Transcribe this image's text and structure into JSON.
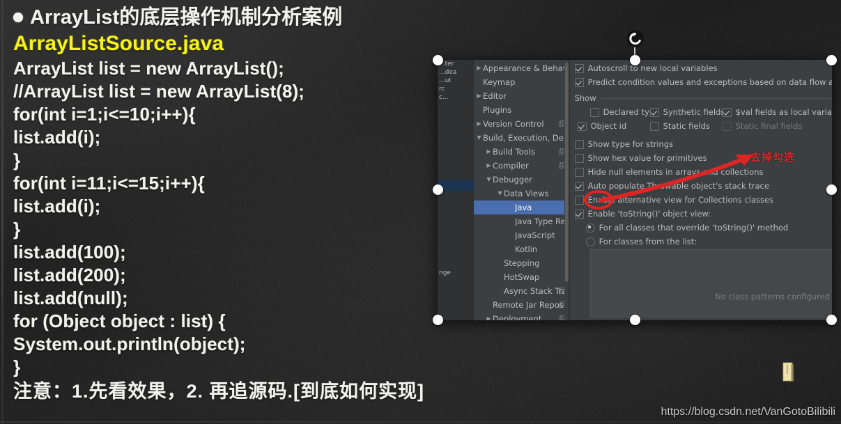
{
  "slide": {
    "bullet_title": "ArrayList的底层操作机制分析案例",
    "file_name": "ArrayListSource.java",
    "code_lines": [
      "ArrayList list = new ArrayList();",
      "//ArrayList list = new ArrayList(8);",
      "for(int i=1;i<=10;i++){",
      "list.add(i);",
      "}",
      "for(int i=11;i<=15;i++){",
      "list.add(i);",
      "}",
      "list.add(100);",
      "list.add(200);",
      "list.add(null);",
      "for (Object object : list) {",
      "System.out.println(object);",
      "}"
    ],
    "note": "注意：1.先看效果，2. 再追源码.[到底如何实现]",
    "watermark": "https://blog.csdn.net/VanGotoBilibili"
  },
  "annotation": {
    "text": "去掉勾选",
    "color": "#d42b2b"
  },
  "ide": {
    "project_tree_fragment": [
      "...ter",
      "...dea",
      "...ut",
      "rc",
      "c...",
      "",
      "",
      "",
      "",
      "",
      "",
      "",
      "nge"
    ],
    "settings_tree": [
      {
        "label": "Appearance & Behavior",
        "arrow": "right",
        "indent": 0,
        "badge": false,
        "selected": false
      },
      {
        "label": "Keymap",
        "arrow": "none",
        "indent": 0,
        "badge": false,
        "selected": false
      },
      {
        "label": "Editor",
        "arrow": "right",
        "indent": 0,
        "badge": false,
        "selected": false
      },
      {
        "label": "Plugins",
        "arrow": "none",
        "indent": 0,
        "badge": false,
        "selected": false
      },
      {
        "label": "Version Control",
        "arrow": "right",
        "indent": 0,
        "badge": true,
        "selected": false
      },
      {
        "label": "Build, Execution, Deployment",
        "arrow": "down",
        "indent": 0,
        "badge": false,
        "selected": false
      },
      {
        "label": "Build Tools",
        "arrow": "right",
        "indent": 1,
        "badge": true,
        "selected": false
      },
      {
        "label": "Compiler",
        "arrow": "right",
        "indent": 1,
        "badge": true,
        "selected": false
      },
      {
        "label": "Debugger",
        "arrow": "down",
        "indent": 1,
        "badge": false,
        "selected": false
      },
      {
        "label": "Data Views",
        "arrow": "down",
        "indent": 2,
        "badge": false,
        "selected": false
      },
      {
        "label": "Java",
        "arrow": "none",
        "indent": 3,
        "badge": false,
        "selected": true
      },
      {
        "label": "Java Type Renderers",
        "arrow": "none",
        "indent": 3,
        "badge": false,
        "selected": false
      },
      {
        "label": "JavaScript",
        "arrow": "none",
        "indent": 3,
        "badge": false,
        "selected": false
      },
      {
        "label": "Kotlin",
        "arrow": "none",
        "indent": 3,
        "badge": false,
        "selected": false
      },
      {
        "label": "Stepping",
        "arrow": "none",
        "indent": 2,
        "badge": false,
        "selected": false
      },
      {
        "label": "HotSwap",
        "arrow": "none",
        "indent": 2,
        "badge": false,
        "selected": false
      },
      {
        "label": "Async Stack Traces",
        "arrow": "none",
        "indent": 2,
        "badge": true,
        "selected": false
      },
      {
        "label": "Remote Jar Repositories",
        "arrow": "none",
        "indent": 1,
        "badge": true,
        "selected": false
      },
      {
        "label": "Deployment",
        "arrow": "right",
        "indent": 1,
        "badge": true,
        "selected": false
      }
    ],
    "options": {
      "autoscroll": {
        "label": "Autoscroll to new local variables",
        "checked": true
      },
      "predict": {
        "label": "Predict condition values and exceptions based on data flow analysis",
        "checked": true
      },
      "show_group_label": "Show",
      "show_group": [
        {
          "label": "Declared type",
          "checked": false,
          "dim": false
        },
        {
          "label": "Synthetic fields",
          "checked": true,
          "dim": false
        },
        {
          "label": "$val fields as local variab",
          "checked": true,
          "dim": false
        },
        {
          "label": "Object id",
          "checked": true,
          "dim": false
        },
        {
          "label": "Static fields",
          "checked": false,
          "dim": false
        },
        {
          "label": "Static final fields",
          "checked": false,
          "dim": true
        }
      ],
      "show_type_for_strings": {
        "label": "Show type for strings",
        "checked": false
      },
      "show_hex": {
        "label": "Show hex value for primitives",
        "checked": false
      },
      "hide_null": {
        "label": "Hide null elements in arrays and collections",
        "checked": false
      },
      "auto_populate": {
        "label": "Auto populate Throwable object's stack trace",
        "checked": true
      },
      "enable_alt_view": {
        "label": "Enable alternative view for Collections classes",
        "checked": false
      },
      "enable_tostring": {
        "label": "Enable 'toString()' object view:",
        "checked": true
      },
      "radio_all": {
        "label": "For all classes that override 'toString()' method",
        "selected": true
      },
      "radio_list": {
        "label": "For classes from the list:",
        "selected": false
      },
      "pattern_placeholder": "No class patterns configured"
    }
  }
}
